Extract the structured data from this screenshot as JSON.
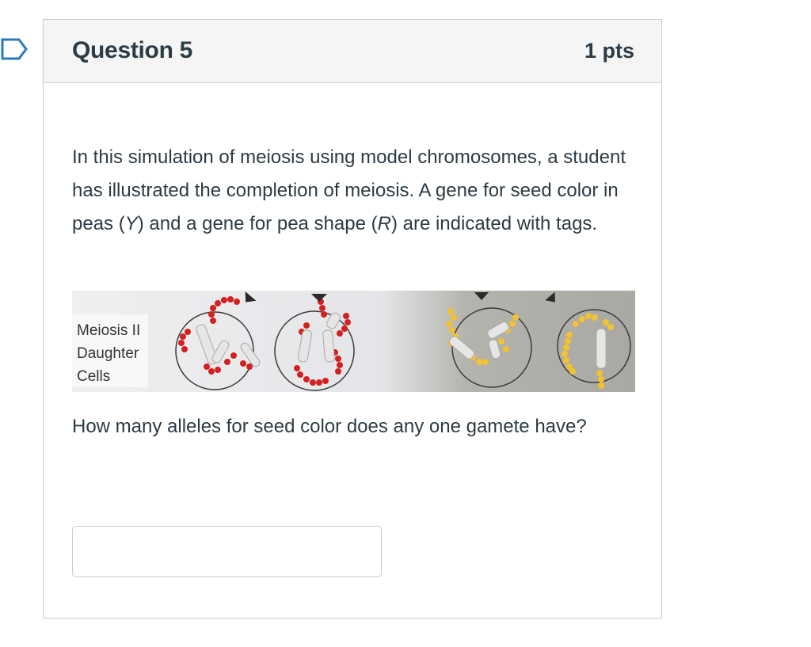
{
  "question": {
    "title": "Question 5",
    "points": "1 pts",
    "text_parts": [
      "In this simulation of meiosis using model chromosomes, a student has illustrated the completion of meiosis. A gene for seed color in peas (",
      "Y",
      ") and a gene for pea shape (",
      "R",
      ") are indicated with tags."
    ],
    "figure_label": [
      "Meiosis II",
      "Daughter",
      "Cells"
    ],
    "prompt": "How many alleles for seed color does any one gamete have?",
    "answer": {
      "value": "",
      "placeholder": ""
    }
  },
  "icons": {
    "flag": "flag-bookmark-icon"
  },
  "colors": {
    "text": "#2d3b45",
    "header_bg": "#f5f5f5",
    "border": "#c7cdd1",
    "flag": "#2b7abc",
    "red_beads": "#d32020",
    "yellow_beads": "#f2c230"
  }
}
